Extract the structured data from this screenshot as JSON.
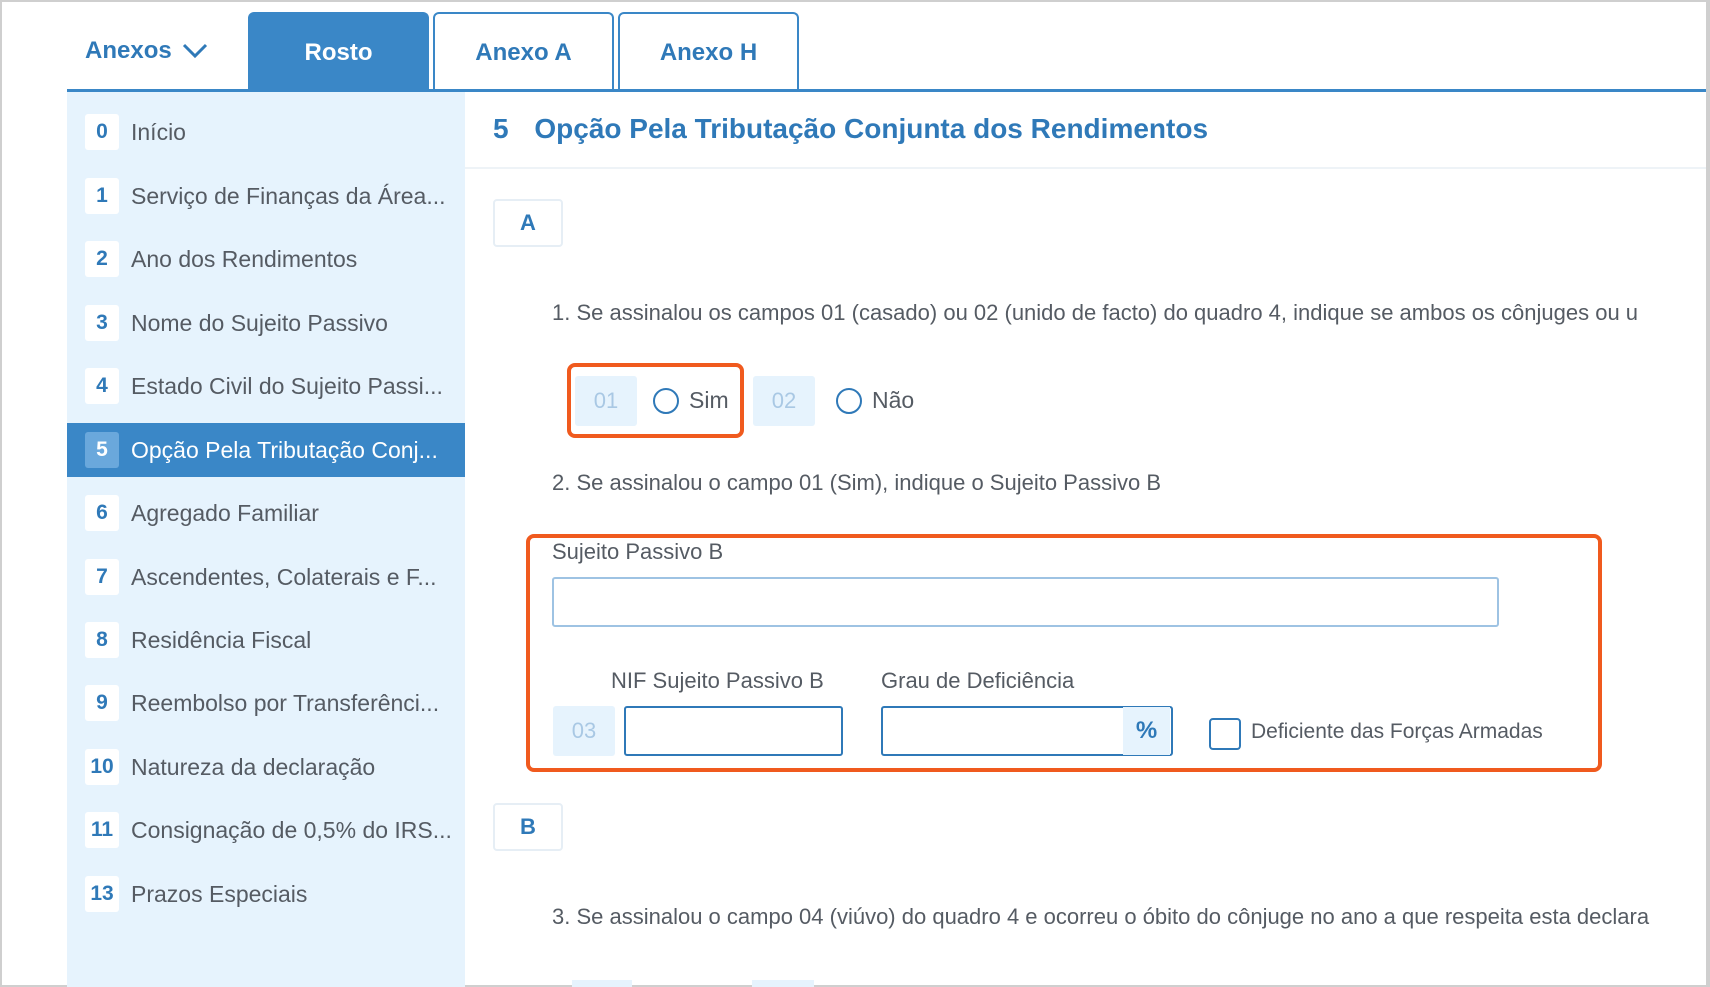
{
  "tabs": {
    "menu_label": "Anexos",
    "items": [
      {
        "label": "Rosto",
        "active": true
      },
      {
        "label": "Anexo A",
        "active": false
      },
      {
        "label": "Anexo H",
        "active": false
      }
    ]
  },
  "sidebar": {
    "items": [
      {
        "num": "0",
        "label": "Início"
      },
      {
        "num": "1",
        "label": "Serviço de Finanças da Área..."
      },
      {
        "num": "2",
        "label": "Ano dos Rendimentos"
      },
      {
        "num": "3",
        "label": "Nome do Sujeito Passivo"
      },
      {
        "num": "4",
        "label": "Estado Civil do Sujeito Passi..."
      },
      {
        "num": "5",
        "label": "Opção Pela Tributação Conj...",
        "active": true
      },
      {
        "num": "6",
        "label": "Agregado Familiar"
      },
      {
        "num": "7",
        "label": "Ascendentes, Colaterais e F..."
      },
      {
        "num": "8",
        "label": "Residência Fiscal"
      },
      {
        "num": "9",
        "label": "Reembolso por Transferênci..."
      },
      {
        "num": "10",
        "label": "Natureza da declaração"
      },
      {
        "num": "11",
        "label": "Consignação de 0,5% do IRS..."
      },
      {
        "num": "13",
        "label": "Prazos Especiais"
      }
    ]
  },
  "main": {
    "section_number": "5",
    "section_title": "Opção Pela Tributação Conjunta dos Rendimentos",
    "box_a": "A",
    "box_b": "B",
    "q1": "1. Se assinalou os campos 01 (casado) ou 02 (unido de facto) do quadro 4, indique se ambos os cônjuges ou u",
    "code_01": "01",
    "opt_sim": "Sim",
    "code_02": "02",
    "opt_nao": "Não",
    "q2": "2. Se assinalou o campo 01 (Sim), indique o Sujeito Passivo B",
    "sujeito_label": "Sujeito Passivo B",
    "sujeito_value": "",
    "nif_label": "NIF Sujeito Passivo B",
    "code_03": "03",
    "nif_value": "",
    "grau_label": "Grau de Deficiência",
    "grau_value": "",
    "pct": "%",
    "deficiente_label": "Deficiente das Forças Armadas",
    "q3": "3. Se assinalou o campo 04 (viúvo) do quadro 4 e ocorreu o óbito do cônjuge no ano a que respeita esta declara"
  },
  "colors": {
    "brand_blue": "#3a87c7",
    "sidebar_bg": "#e6f3fd",
    "highlight_orange": "#f05a1e"
  }
}
